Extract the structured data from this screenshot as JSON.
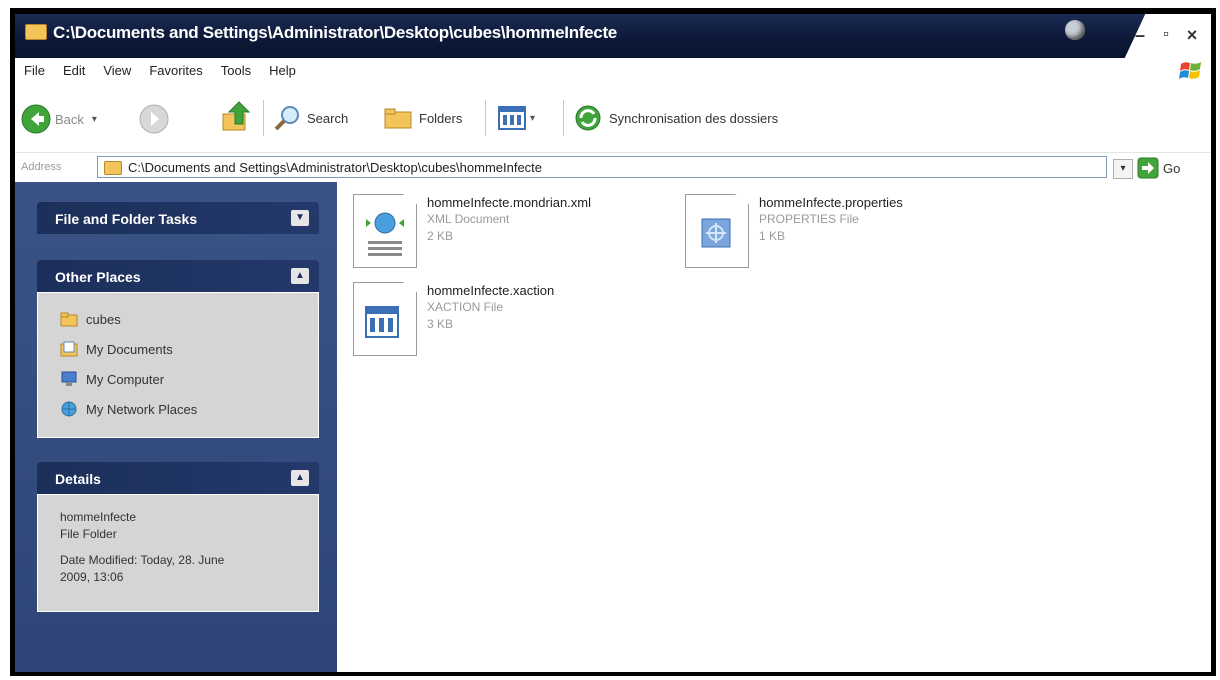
{
  "window": {
    "title": "C:\\Documents and Settings\\Administrator\\Desktop\\cubes\\hommeInfecte",
    "minimize": "–",
    "maximize": "▫",
    "close": "×"
  },
  "menu": [
    "File",
    "Edit",
    "View",
    "Favorites",
    "Tools",
    "Help"
  ],
  "toolbar": {
    "back": "Back",
    "search": "Search",
    "folders": "Folders",
    "sync": "Synchronisation des dossiers"
  },
  "address": {
    "label": "Address",
    "value": "C:\\Documents and Settings\\Administrator\\Desktop\\cubes\\hommeInfecte",
    "go": "Go"
  },
  "sidebar": {
    "file_tasks": {
      "title": "File and Folder Tasks"
    },
    "other_places": {
      "title": "Other Places",
      "items": [
        {
          "label": "cubes",
          "icon": "folder-icon"
        },
        {
          "label": "My Documents",
          "icon": "my-documents-icon"
        },
        {
          "label": "My Computer",
          "icon": "my-computer-icon"
        },
        {
          "label": "My Network Places",
          "icon": "network-places-icon"
        }
      ]
    },
    "details": {
      "title": "Details",
      "name": "hommeInfecte",
      "type": "File Folder",
      "modified_line1": "Date Modified: Today, 28. June",
      "modified_line2": "2009, 13:06"
    }
  },
  "files": [
    {
      "name": "hommeInfecte.mondrian.xml",
      "type": "XML Document",
      "size": "2 KB",
      "icon": "xml-document-icon"
    },
    {
      "name": "hommeInfecte.properties",
      "type": "PROPERTIES File",
      "size": "1 KB",
      "icon": "properties-file-icon"
    },
    {
      "name": "hommeInfecte.xaction",
      "type": "XACTION File",
      "size": "3 KB",
      "icon": "xaction-file-icon"
    }
  ],
  "colors": {
    "title_bar": "#0c1836",
    "sidebar": "#2f4577",
    "panel_body": "#d5d5d5"
  }
}
